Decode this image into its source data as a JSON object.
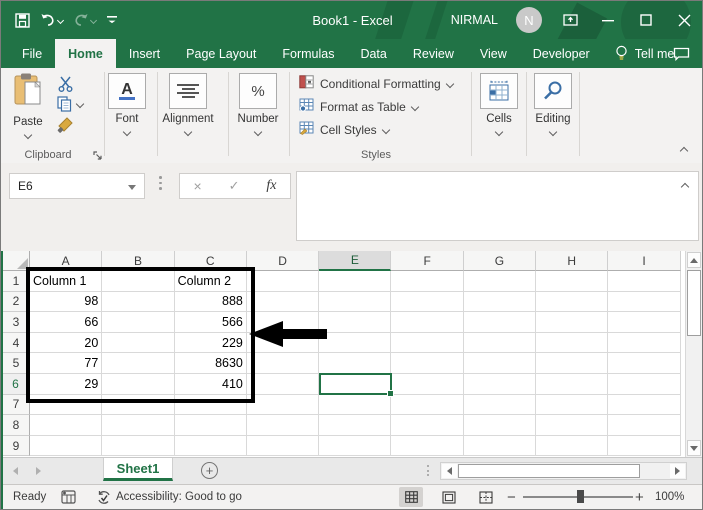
{
  "window": {
    "title": "Book1  -  Excel",
    "user_name": "NIRMAL",
    "avatar_initial": "N"
  },
  "tabs": [
    {
      "label": "File",
      "active": false
    },
    {
      "label": "Home",
      "active": true
    },
    {
      "label": "Insert",
      "active": false
    },
    {
      "label": "Page Layout",
      "active": false
    },
    {
      "label": "Formulas",
      "active": false
    },
    {
      "label": "Data",
      "active": false
    },
    {
      "label": "Review",
      "active": false
    },
    {
      "label": "View",
      "active": false
    },
    {
      "label": "Developer",
      "active": false
    }
  ],
  "tell_me": "Tell me",
  "ribbon": {
    "paste_label": "Paste",
    "clipboard_group": "Clipboard",
    "font_label": "Font",
    "font_symbol": "A",
    "alignment_label": "Alignment",
    "number_label": "Number",
    "number_symbol": "%",
    "styles_items": [
      "Conditional Formatting",
      "Format as Table",
      "Cell Styles"
    ],
    "styles_group": "Styles",
    "cells_label": "Cells",
    "editing_label": "Editing"
  },
  "formula_bar": {
    "name_box": "E6",
    "cancel_symbol": "×",
    "enter_symbol": "✓",
    "fx_label": "fx",
    "content": ""
  },
  "grid": {
    "column_headers": [
      "A",
      "B",
      "C",
      "D",
      "E",
      "F",
      "G",
      "H",
      "I"
    ],
    "row_headers": [
      1,
      2,
      3,
      4,
      5,
      6,
      7,
      8,
      9
    ],
    "selected_column": "E",
    "selected_row": 6,
    "active_cell": "E6",
    "cells": {
      "A1": "Column 1",
      "C1": "Column 2",
      "A2": "98",
      "C2": "888",
      "A3": "66",
      "C3": "566",
      "A4": "20",
      "C4": "229",
      "A5": "77",
      "C5": "8630",
      "A6": "29",
      "C6": "410"
    }
  },
  "sheet_bar": {
    "active_sheet": "Sheet1",
    "add_sheet_symbol": "+"
  },
  "status_bar": {
    "ready": "Ready",
    "accessibility": "Accessibility: Good to go",
    "zoom_minus": "−",
    "zoom_plus": "+",
    "zoom_percent": "100%"
  },
  "colors": {
    "excel_green": "#217346",
    "selection_green": "#217346",
    "annotation_black": "#000000"
  }
}
